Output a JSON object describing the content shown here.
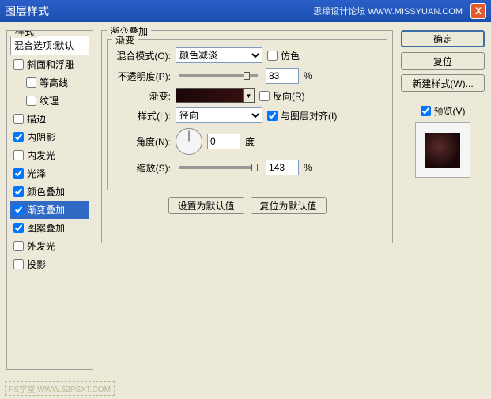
{
  "titlebar": {
    "title": "图层样式",
    "brand": "思缘设计论坛  WWW.MISSYUAN.COM",
    "close": "X"
  },
  "styles": {
    "legend": "样式",
    "headerLabel": "混合选项:默认",
    "items": [
      {
        "label": "斜面和浮雕",
        "checked": false,
        "indent": 0
      },
      {
        "label": "等高线",
        "checked": false,
        "indent": 1
      },
      {
        "label": "纹理",
        "checked": false,
        "indent": 1
      },
      {
        "label": "描边",
        "checked": false,
        "indent": 0
      },
      {
        "label": "内阴影",
        "checked": true,
        "indent": 0
      },
      {
        "label": "内发光",
        "checked": false,
        "indent": 0
      },
      {
        "label": "光泽",
        "checked": true,
        "indent": 0
      },
      {
        "label": "颜色叠加",
        "checked": true,
        "indent": 0
      },
      {
        "label": "渐变叠加",
        "checked": true,
        "indent": 0,
        "selected": true
      },
      {
        "label": "图案叠加",
        "checked": true,
        "indent": 0
      },
      {
        "label": "外发光",
        "checked": false,
        "indent": 0
      },
      {
        "label": "投影",
        "checked": false,
        "indent": 0
      }
    ]
  },
  "main": {
    "legend": "渐变叠加",
    "innerLegend": "渐变",
    "blendLabel": "混合模式(O):",
    "blendValue": "颜色减淡",
    "ditherLabel": "仿色",
    "ditherChecked": false,
    "opacityLabel": "不透明度(P):",
    "opacityValue": "83",
    "pct": "%",
    "gradLabel": "渐变:",
    "reverseLabel": "反向(R)",
    "reverseChecked": false,
    "styleLabel": "样式(L):",
    "styleValue": "径向",
    "alignLabel": "与图层对齐(I)",
    "alignChecked": true,
    "angleLabel": "角度(N):",
    "angleValue": "0",
    "angleUnit": "度",
    "scaleLabel": "缩放(S):",
    "scaleValue": "143",
    "setDefault": "设置为默认值",
    "resetDefault": "复位为默认值"
  },
  "right": {
    "ok": "确定",
    "cancel": "复位",
    "newStyle": "新建样式(W)...",
    "previewLabel": "预览(V)",
    "previewChecked": true
  },
  "footer": "PS学堂  WWW.52PSXT.COM"
}
